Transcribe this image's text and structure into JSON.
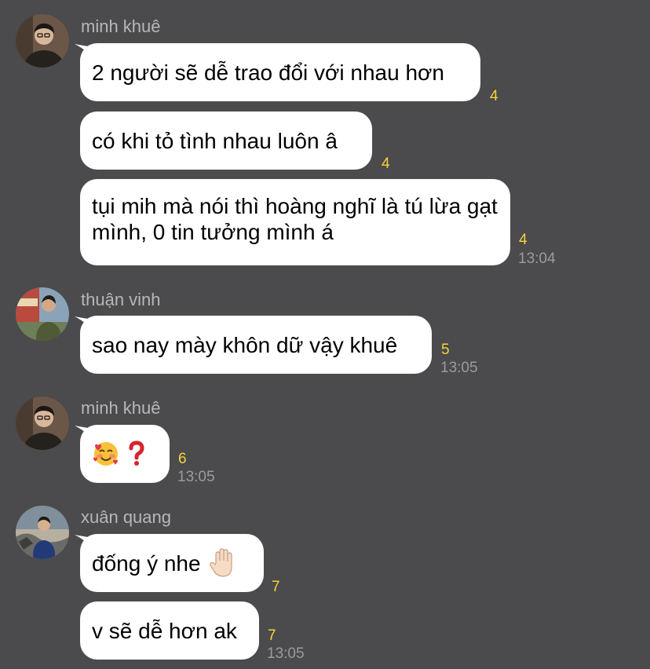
{
  "groups": [
    {
      "sender": "minh khuê",
      "messages": [
        {
          "text": "2 người sẽ dễ trao đổi với nhau hơn",
          "unread": "4"
        },
        {
          "text": "có khi tỏ tình nhau luôn â",
          "unread": "4"
        },
        {
          "text": "tụi mih mà nói thì hoàng nghĩ là tú lừa gạt mình, 0 tin tưởng mình á",
          "unread": "4",
          "time": "13:04"
        }
      ]
    },
    {
      "sender": "thuận vinh",
      "messages": [
        {
          "text": "sao nay mày khôn dữ vậy khuê",
          "unread": "5",
          "time": "13:05"
        }
      ]
    },
    {
      "sender": "minh khuê",
      "messages": [
        {
          "emoji": [
            "smiling-face-with-hearts",
            "red-question-mark"
          ],
          "unread": "6",
          "time": "13:05"
        }
      ]
    },
    {
      "sender": "xuân quang",
      "messages": [
        {
          "text": "đống ý nhe",
          "emoji": [
            "raised-hand"
          ],
          "unread": "7"
        },
        {
          "text": "v sẽ dễ hơn ak",
          "unread": "7",
          "time": "13:05"
        }
      ]
    }
  ],
  "colors": {
    "background": "#4b4a4c",
    "bubble": "#ffffff",
    "unread_count": "#f5d33b",
    "sender_name": "#b7b6b8",
    "timestamp": "#9b9a9c"
  }
}
